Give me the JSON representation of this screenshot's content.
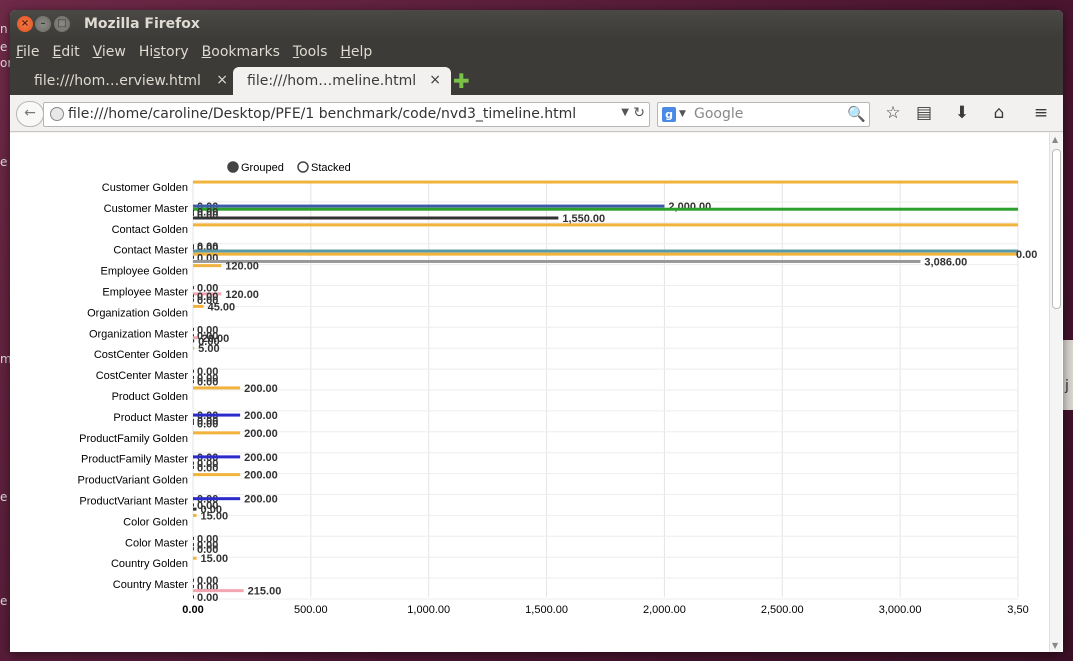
{
  "desktop": {
    "left_fragments": [
      "n",
      "e",
      "or",
      "e",
      "m",
      "e",
      "e"
    ],
    "right_fragment": "j"
  },
  "window": {
    "title": "Mozilla Firefox",
    "close_glyph": "×",
    "min_glyph": "–",
    "max_glyph": "□"
  },
  "menu": {
    "items": [
      {
        "key": "F",
        "rest": "ile"
      },
      {
        "key": "E",
        "rest": "dit"
      },
      {
        "key": "V",
        "rest": "iew"
      },
      {
        "key": "",
        "rest": "Hi",
        "key2": "s",
        "rest2": "tory"
      },
      {
        "key": "B",
        "rest": "ookmarks"
      },
      {
        "key": "T",
        "rest": "ools"
      },
      {
        "key": "H",
        "rest": "elp"
      }
    ]
  },
  "tabs": [
    {
      "label": "file:///hom…erview.html",
      "close": "×"
    },
    {
      "label": "file:///hom…meline.html",
      "close": "×"
    }
  ],
  "newtab_glyph": "✚",
  "nav": {
    "back_glyph": "←",
    "url": "file:///home/caroline/Desktop/PFE/1 benchmark/code/nvd3_timeline.html",
    "url_drop": "▼",
    "reload": "↻",
    "search_engine": "g",
    "search_drop": "▼",
    "search_placeholder": "Google",
    "search_mag": "🔍",
    "star": "☆",
    "clipboard": "▤",
    "download": "⬇",
    "home": "⌂",
    "menu": "≡"
  },
  "chart_data": {
    "type": "bar",
    "orientation": "horizontal",
    "legend": {
      "placement": "top-left",
      "items": [
        {
          "label": "Grouped",
          "selected": true
        },
        {
          "label": "Stacked",
          "selected": false
        }
      ]
    },
    "categories": [
      "Customer Golden",
      "Customer Master",
      "Contact Golden",
      "Contact Master",
      "Employee Golden",
      "Employee Master",
      "Organization Golden",
      "Organization Master",
      "CostCenter Golden",
      "CostCenter Master",
      "Product Golden",
      "Product Master",
      "ProductFamily Golden",
      "ProductFamily Master",
      "ProductVariant Golden",
      "ProductVariant Master",
      "Color Golden",
      "Color Master",
      "Country Golden",
      "Country Master"
    ],
    "xlim": [
      0,
      3500
    ],
    "x_ticks": [
      "0.00",
      "500.00",
      "1,000.00",
      "1,500.00",
      "2,000.00",
      "2,500.00",
      "3,000.00",
      "3,50"
    ],
    "x_tick_values": [
      0,
      500,
      1000,
      1500,
      2000,
      2500,
      3000,
      3500
    ],
    "grid": true,
    "colors": {
      "orange": "#f2b33d",
      "blue": "#3b5ba8",
      "green": "#2ca02c",
      "dark": "#333333",
      "gray": "#999999",
      "navy": "#2b2bcc",
      "pink": "#f4a6b0",
      "teal": "#5a9aa8"
    },
    "bars": [
      {
        "category_index": 0,
        "slot": -0.45,
        "value": 3500,
        "color": "orange",
        "label": ""
      },
      {
        "category_index": 0,
        "slot": 0.7,
        "value": 0,
        "color": "dark",
        "label": "0.00"
      },
      {
        "category_index": 1,
        "slot": -0.3,
        "value": 2000,
        "color": "blue",
        "label": "2,000.00"
      },
      {
        "category_index": 1,
        "slot": -0.15,
        "value": 3500,
        "color": "green",
        "label": ""
      },
      {
        "category_index": 1,
        "slot": -0.05,
        "value": 0,
        "color": "dark",
        "label": "0.00"
      },
      {
        "category_index": 1,
        "slot": 0.1,
        "value": 0,
        "color": "dark",
        "label": "0.00"
      },
      {
        "category_index": 1,
        "slot": 0.27,
        "value": 1550,
        "color": "dark",
        "label": "1,550.00"
      },
      {
        "category_index": 1,
        "slot": 0.6,
        "value": 3500,
        "color": "orange",
        "label": ""
      },
      {
        "category_index": 2,
        "slot": 0.6,
        "value": 0,
        "color": "dark",
        "label": "0.00"
      },
      {
        "category_index": 2,
        "slot": 0.7,
        "value": 0,
        "color": "dark",
        "label": "0.00"
      },
      {
        "category_index": 3,
        "slot": -0.15,
        "value": 3500,
        "color": "teal",
        "label": ""
      },
      {
        "category_index": 3,
        "slot": 0.0,
        "value": 3500,
        "color": "orange",
        "label": "0.00"
      },
      {
        "category_index": 3,
        "slot": 0.15,
        "value": 0,
        "color": "dark",
        "label": "0.00"
      },
      {
        "category_index": 3,
        "slot": 0.35,
        "value": 3086,
        "color": "gray",
        "label": "3,086.00"
      },
      {
        "category_index": 4,
        "slot": -0.45,
        "value": 120,
        "color": "orange",
        "label": "120.00"
      },
      {
        "category_index": 4,
        "slot": 0.6,
        "value": 0,
        "color": "dark",
        "label": "0.00"
      },
      {
        "category_index": 5,
        "slot": -0.1,
        "value": 120,
        "color": "pink",
        "label": "120.00"
      },
      {
        "category_index": 5,
        "slot": 0.0,
        "value": 0,
        "color": "dark",
        "label": "0.00"
      },
      {
        "category_index": 5,
        "slot": 0.2,
        "value": 0,
        "color": "dark",
        "label": "0.00"
      },
      {
        "category_index": 5,
        "slot": 0.5,
        "value": 45,
        "color": "orange",
        "label": "45.00"
      },
      {
        "category_index": 6,
        "slot": 0.6,
        "value": 0,
        "color": "dark",
        "label": "0.00"
      },
      {
        "category_index": 7,
        "slot": -0.1,
        "value": 0,
        "color": "dark",
        "label": "0.00"
      },
      {
        "category_index": 7,
        "slot": 0.0,
        "value": 20,
        "color": "pink",
        "label": "20.00"
      },
      {
        "category_index": 7,
        "slot": 0.15,
        "value": 5,
        "color": "dark",
        "label": "0.00"
      },
      {
        "category_index": 7,
        "slot": 0.5,
        "value": 5,
        "color": "orange",
        "label": "5.00"
      },
      {
        "category_index": 8,
        "slot": 0.6,
        "value": 0,
        "color": "dark",
        "label": "0.00"
      },
      {
        "category_index": 9,
        "slot": -0.1,
        "value": 0,
        "color": "dark",
        "label": "0.00"
      },
      {
        "category_index": 9,
        "slot": 0.1,
        "value": 0,
        "color": "dark",
        "label": "0.00"
      },
      {
        "category_index": 9,
        "slot": 0.4,
        "value": 200,
        "color": "orange",
        "label": "200.00"
      },
      {
        "category_index": 10,
        "slot": 0.7,
        "value": 0,
        "color": "dark",
        "label": "0.00"
      },
      {
        "category_index": 11,
        "slot": -0.3,
        "value": 200,
        "color": "navy",
        "label": "200.00"
      },
      {
        "category_index": 11,
        "slot": -0.05,
        "value": 0,
        "color": "dark",
        "label": "0.00"
      },
      {
        "category_index": 11,
        "slot": 0.1,
        "value": 0,
        "color": "dark",
        "label": "0.00"
      },
      {
        "category_index": 11,
        "slot": 0.55,
        "value": 200,
        "color": "orange",
        "label": "200.00"
      },
      {
        "category_index": 12,
        "slot": 0.7,
        "value": 0,
        "color": "dark",
        "label": "0.00"
      },
      {
        "category_index": 13,
        "slot": -0.3,
        "value": 200,
        "color": "navy",
        "label": "200.00"
      },
      {
        "category_index": 13,
        "slot": 0.0,
        "value": 0,
        "color": "dark",
        "label": "0.00"
      },
      {
        "category_index": 13,
        "slot": 0.2,
        "value": 0,
        "color": "dark",
        "label": "0.00"
      },
      {
        "category_index": 13,
        "slot": 0.55,
        "value": 200,
        "color": "orange",
        "label": "200.00"
      },
      {
        "category_index": 14,
        "slot": 0.7,
        "value": 0,
        "color": "dark",
        "label": "0.00"
      },
      {
        "category_index": 15,
        "slot": -0.3,
        "value": 200,
        "color": "navy",
        "label": "200.00"
      },
      {
        "category_index": 15,
        "slot": 0.0,
        "value": 0,
        "color": "dark",
        "label": "0.00"
      },
      {
        "category_index": 15,
        "slot": 0.2,
        "value": 15,
        "color": "dark",
        "label": "0.00"
      },
      {
        "category_index": 15,
        "slot": 0.5,
        "value": 15,
        "color": "orange",
        "label": "15.00"
      },
      {
        "category_index": 16,
        "slot": 0.6,
        "value": 0,
        "color": "dark",
        "label": "0.00"
      },
      {
        "category_index": 17,
        "slot": -0.1,
        "value": 0,
        "color": "dark",
        "label": "0.00"
      },
      {
        "category_index": 17,
        "slot": 0.1,
        "value": 0,
        "color": "dark",
        "label": "0.00"
      },
      {
        "category_index": 17,
        "slot": 0.55,
        "value": 15,
        "color": "orange",
        "label": "15.00"
      },
      {
        "category_index": 18,
        "slot": 0.6,
        "value": 0,
        "color": "dark",
        "label": "0.00"
      },
      {
        "category_index": 19,
        "slot": -0.1,
        "value": 0,
        "color": "dark",
        "label": "0.00"
      },
      {
        "category_index": 19,
        "slot": 0.1,
        "value": 215,
        "color": "pink",
        "label": "215.00"
      },
      {
        "category_index": 19,
        "slot": 0.4,
        "value": 0,
        "color": "dark",
        "label": "0.00"
      }
    ]
  }
}
